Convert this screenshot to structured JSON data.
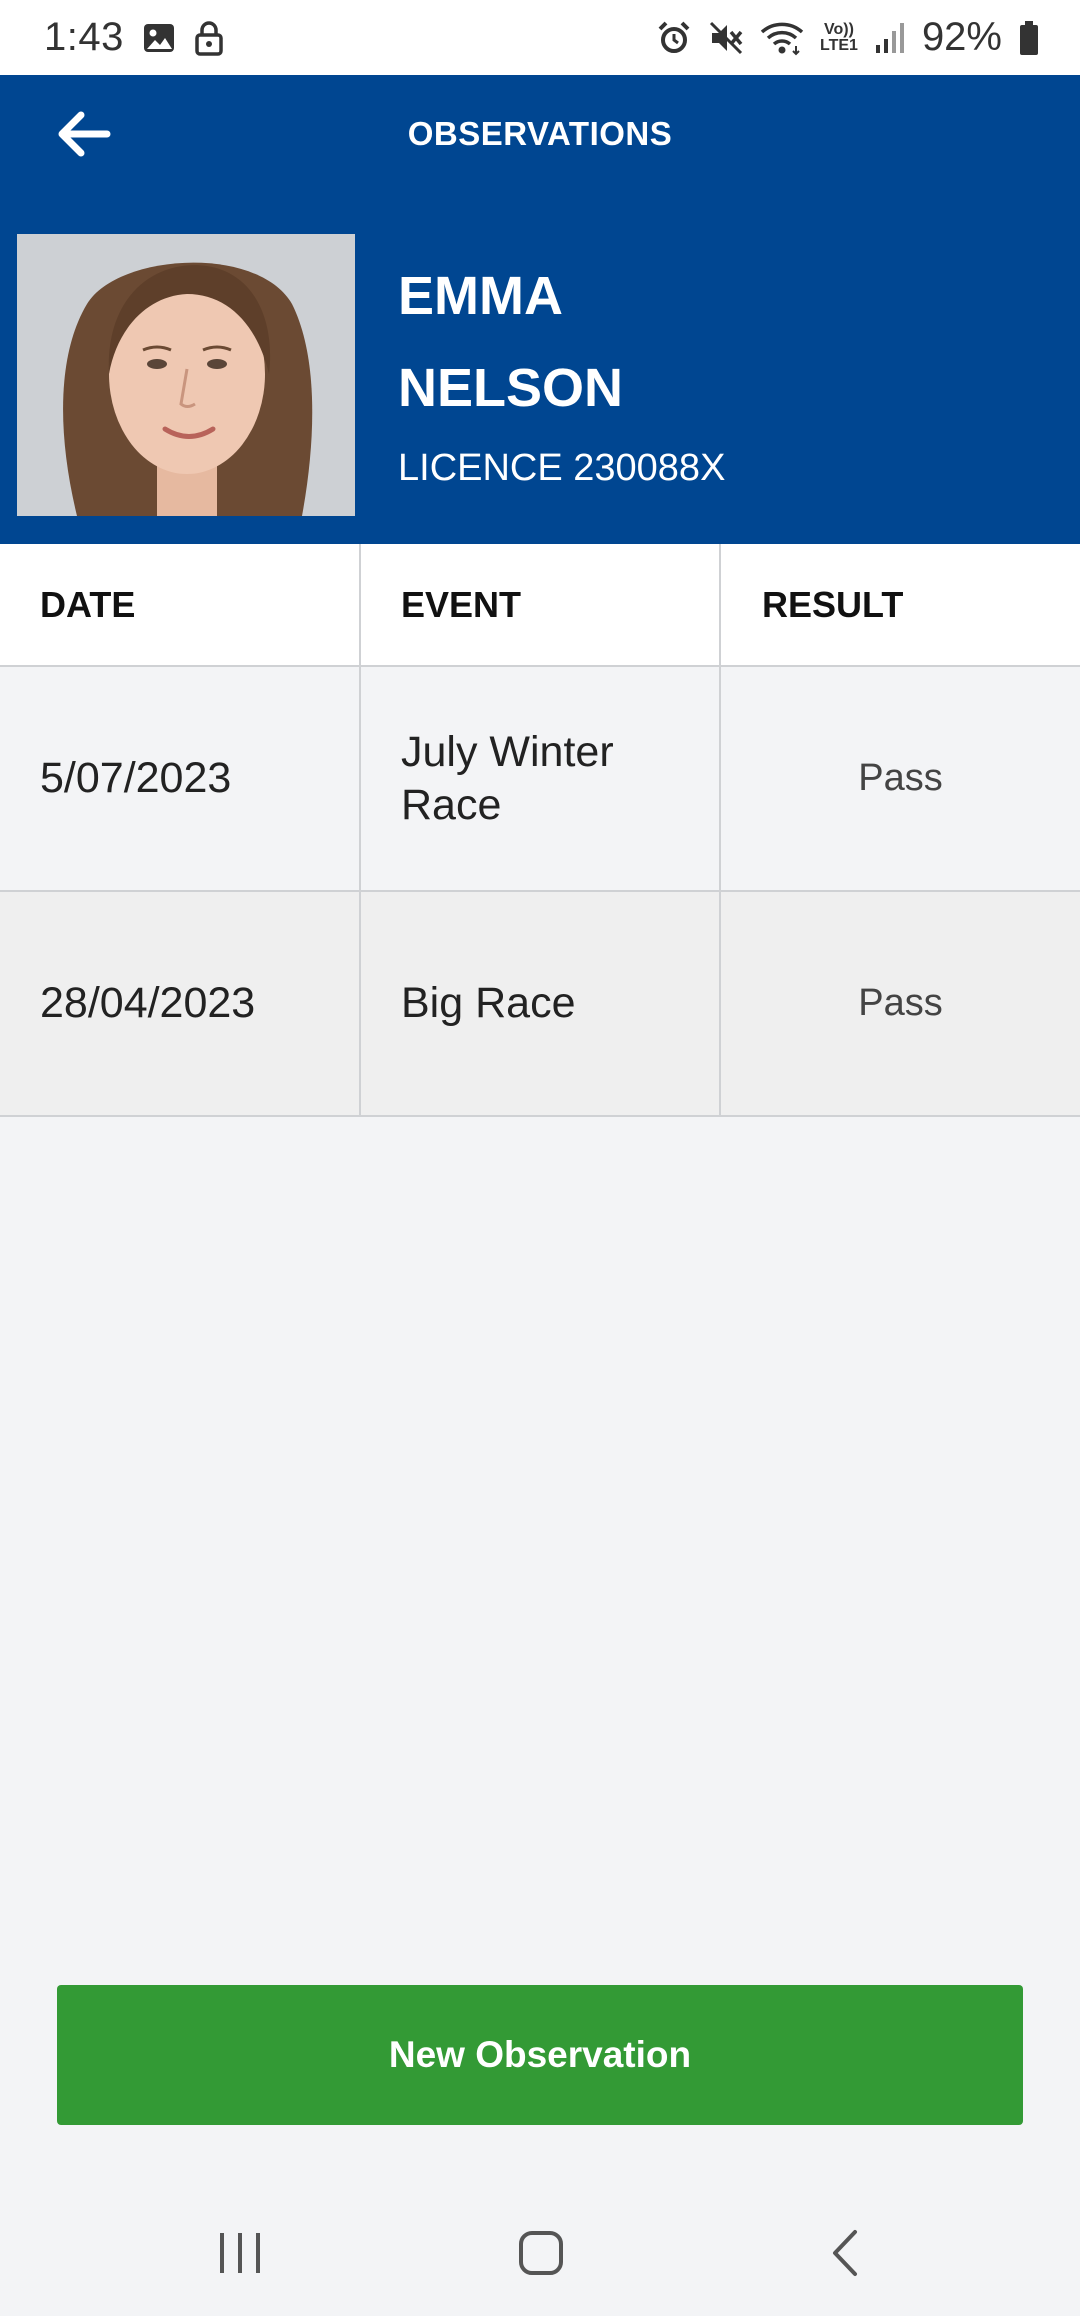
{
  "status_bar": {
    "time": "1:43",
    "battery": "92%",
    "icons_left": [
      "image-icon",
      "lock-icon"
    ],
    "icons_right": [
      "alarm-icon",
      "mute-icon",
      "wifi-icon",
      "volte-icon",
      "signal-icon",
      "battery-icon"
    ],
    "volte_top": "Vo))",
    "volte_bottom": "LTE1"
  },
  "header": {
    "title": "OBSERVATIONS",
    "color": "#004691"
  },
  "profile": {
    "first_name": "EMMA",
    "last_name": "NELSON",
    "licence": "LICENCE 230088X"
  },
  "table": {
    "headers": [
      "DATE",
      "EVENT",
      "RESULT"
    ],
    "rows": [
      {
        "date": "5/07/2023",
        "event": "July Winter Race",
        "result": "Pass"
      },
      {
        "date": "28/04/2023",
        "event": "Big Race",
        "result": "Pass"
      }
    ]
  },
  "actions": {
    "new_observation": "New Observation",
    "button_color": "#339a35"
  },
  "nav": {
    "buttons": [
      "recents-icon",
      "home-icon",
      "back-icon"
    ]
  }
}
